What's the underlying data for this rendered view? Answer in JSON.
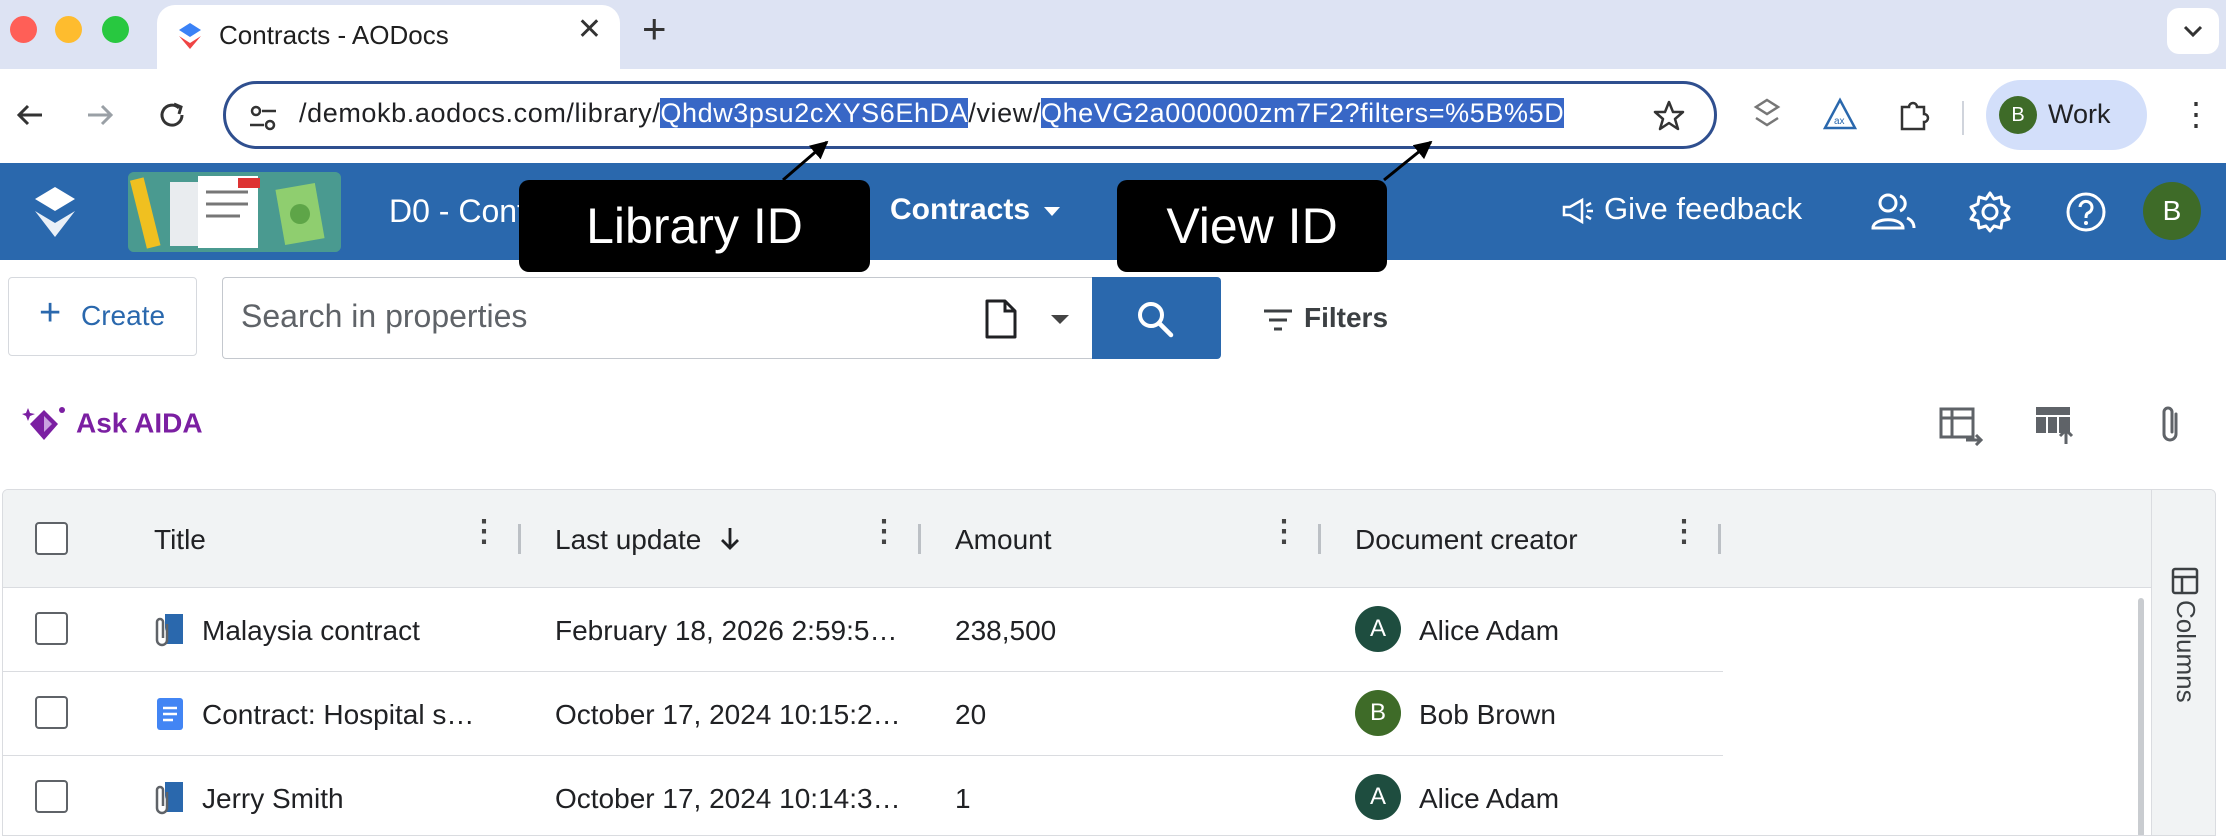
{
  "browser": {
    "tab_title": "Contracts - AODocs",
    "url": {
      "prefix": "/demokb.aodocs.com/library/",
      "library_id": "Qhdw3psu2cXYS6EhDA",
      "middle": "/view/",
      "view_id_and_query": "QheVG2a000000zm7F2?filters=%5B%5D"
    },
    "profile_initial": "B",
    "profile_label": "Work"
  },
  "app": {
    "library_name": "D0 - Cont",
    "view_selector": "Contracts",
    "feedback_label": "Give feedback",
    "user_initial": "B"
  },
  "annotations": {
    "library_id_label": "Library ID",
    "view_id_label": "View ID"
  },
  "actions": {
    "create_label": "Create",
    "search_placeholder": "Search in properties",
    "filters_label": "Filters",
    "ask_aida_label": "Ask AIDA"
  },
  "table": {
    "columns": [
      "Title",
      "Last update",
      "Amount",
      "Document creator"
    ],
    "side_panel_label": "Columns",
    "rows": [
      {
        "title": "Malaysia contract",
        "icon": "attachment-doc-icon",
        "last_update": "February 18, 2026 2:59:5…",
        "amount": "238,500",
        "creator_initial": "A",
        "creator": "Alice Adam",
        "creator_color": "#1e4d3f"
      },
      {
        "title": "Contract: Hospital s…",
        "icon": "google-doc-icon",
        "last_update": "October 17, 2024 10:15:2…",
        "amount": "20",
        "creator_initial": "B",
        "creator": "Bob Brown",
        "creator_color": "#3e6b28"
      },
      {
        "title": "Jerry Smith",
        "icon": "attachment-doc-icon",
        "last_update": "October 17, 2024 10:14:3…",
        "amount": "1",
        "creator_initial": "A",
        "creator": "Alice Adam",
        "creator_color": "#1e4d3f"
      }
    ]
  },
  "colors": {
    "brand_blue": "#2a68ad",
    "aida_purple": "#7b1fa2",
    "url_highlight": "#3867c6"
  }
}
